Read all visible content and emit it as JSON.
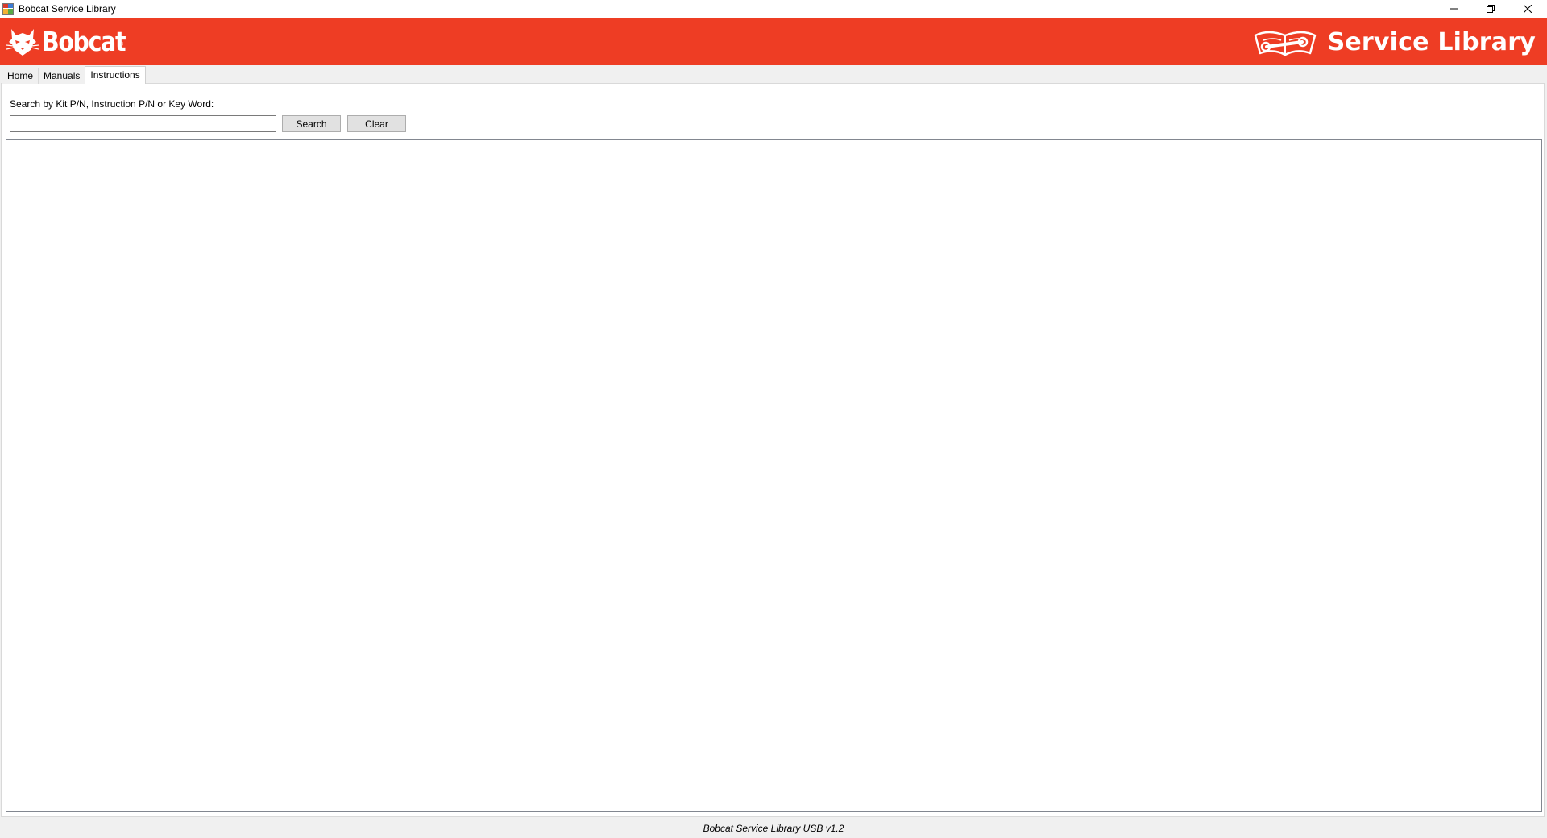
{
  "window": {
    "title": "Bobcat Service Library",
    "app_icon": "app-icon",
    "controls": {
      "minimize_icon": "minimize-icon",
      "restore_icon": "restore-icon",
      "close_icon": "close-icon"
    }
  },
  "header": {
    "brand": "Bobcat",
    "brand_mark": "®",
    "brand_icon": "bobcat-head-icon",
    "library_icon": "open-book-wrench-icon",
    "library_title": "Service Library",
    "background_color": "#ee3d24",
    "text_color": "#ffffff"
  },
  "tabs": [
    {
      "label": "Home",
      "active": false
    },
    {
      "label": "Manuals",
      "active": false
    },
    {
      "label": "Instructions",
      "active": true
    }
  ],
  "search": {
    "label": "Search by Kit P/N, Instruction P/N or Key Word:",
    "value": "",
    "placeholder": "",
    "search_button": "Search",
    "clear_button": "Clear"
  },
  "status": {
    "text": "Bobcat Service Library USB v1.2"
  }
}
